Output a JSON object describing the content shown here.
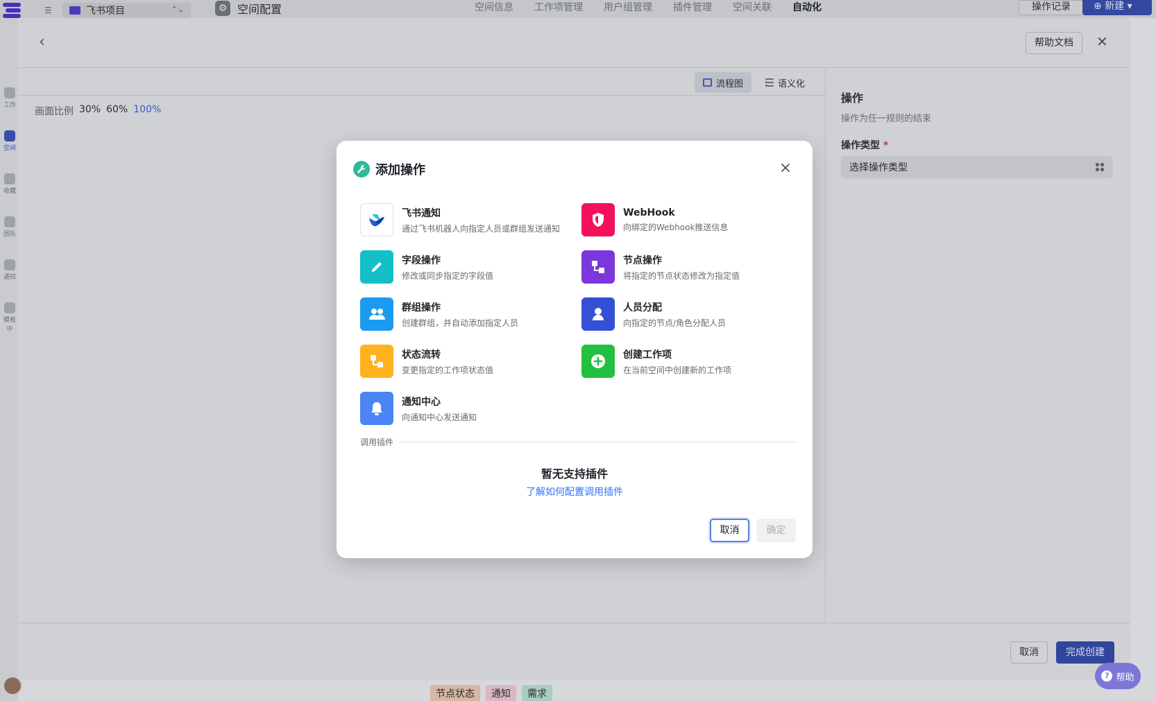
{
  "app": {
    "project_name": "飞书项目",
    "space_title": "空间配置",
    "tabs": [
      "空间信息",
      "工作项管理",
      "用户组管理",
      "插件管理",
      "空间关联",
      "自动化"
    ],
    "active_tab": "自动化",
    "op_log_label": "操作记录",
    "new_label": "新建",
    "sidebar": [
      "工作",
      "空间",
      "收藏",
      "团队",
      "通知",
      "模板中"
    ],
    "bottom_tags": [
      "节点状态",
      "通知",
      "需求"
    ]
  },
  "drawer": {
    "help_doc_label": "帮助文档",
    "view_flow_label": "流程图",
    "view_semantic_label": "语义化",
    "zoom_label": "画面比例",
    "zoom_levels": [
      "30%",
      "60%",
      "100%"
    ],
    "active_zoom": "100%",
    "panel": {
      "title": "操作",
      "desc": "操作为任一规则的结束",
      "type_label": "操作类型",
      "required_mark": "*",
      "type_placeholder": "选择操作类型"
    },
    "cancel_label": "取消",
    "finish_label": "完成创建",
    "help_label": "帮助"
  },
  "modal": {
    "title": "添加操作",
    "operations": [
      {
        "name": "飞书通知",
        "desc": "通过飞书机器人向指定人员或群组发送通知",
        "icon": "feishu-icon",
        "color": "#ffffff"
      },
      {
        "name": "WebHook",
        "desc": "向绑定的Webhook推送信息",
        "icon": "shield-icon",
        "color": "#f5105a"
      },
      {
        "name": "字段操作",
        "desc": "修改或同步指定的字段值",
        "icon": "pencil-icon",
        "color": "#14bfc7"
      },
      {
        "name": "节点操作",
        "desc": "将指定的节点状态修改为指定值",
        "icon": "node-flow-icon",
        "color": "#7b37db"
      },
      {
        "name": "群组操作",
        "desc": "创建群组，并自动添加指定人员",
        "icon": "group-icon",
        "color": "#1a9bf0"
      },
      {
        "name": "人员分配",
        "desc": "向指定的节点/角色分配人员",
        "icon": "person-icon",
        "color": "#3350d6"
      },
      {
        "name": "状态流转",
        "desc": "变更指定的工作项状态值",
        "icon": "status-flow-icon",
        "color": "#ffb21e"
      },
      {
        "name": "创建工作项",
        "desc": "在当前空间中创建新的工作项",
        "icon": "plus-circle-icon",
        "color": "#22c03f"
      },
      {
        "name": "通知中心",
        "desc": "向通知中心发送通知",
        "icon": "bell-icon",
        "color": "#4a84f5"
      }
    ],
    "plugin_section_label": "调用插件",
    "no_plugin_text": "暂无支持插件",
    "plugin_link_text": "了解如何配置调用插件",
    "cancel_label": "取消",
    "confirm_label": "确定"
  }
}
